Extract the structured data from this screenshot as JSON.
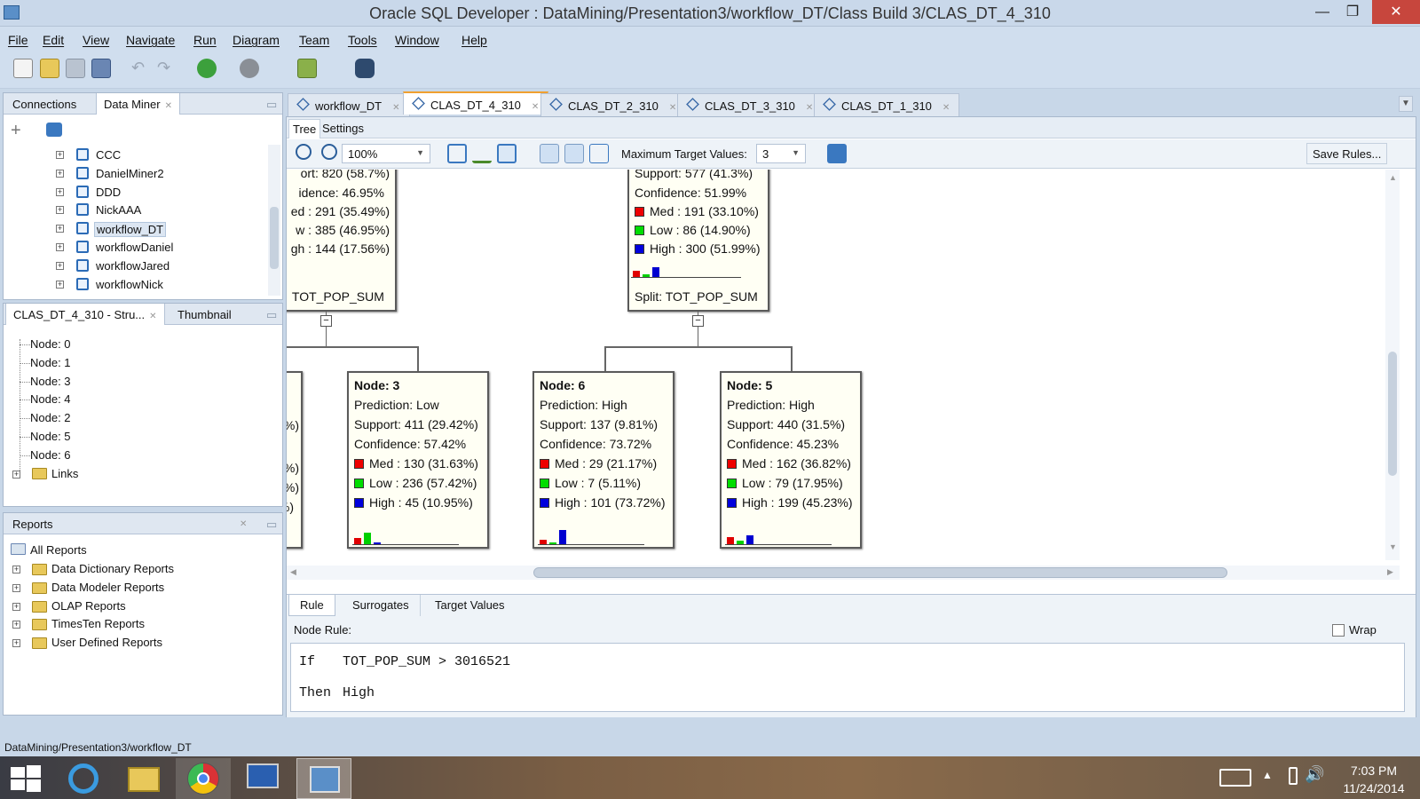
{
  "window": {
    "title": "Oracle SQL Developer : DataMining/Presentation3/workflow_DT/Class Build 3/CLAS_DT_4_310"
  },
  "menu": [
    "File",
    "Edit",
    "View",
    "Navigate",
    "Run",
    "Diagram",
    "Team",
    "Tools",
    "Window",
    "Help"
  ],
  "left_top": {
    "tabs": [
      "Connections",
      "Data Miner"
    ],
    "items": [
      "CCC",
      "DanielMiner2",
      "DDD",
      "NickAAA",
      "workflow_DT",
      "workflowDaniel",
      "workflowJared",
      "workflowNick"
    ],
    "selected": "workflow_DT"
  },
  "structure": {
    "tabs": [
      "CLAS_DT_4_310 - Stru...",
      "Thumbnail"
    ],
    "nodes": [
      "Node: 0",
      "Node: 1",
      "Node: 3",
      "Node: 4",
      "Node: 2",
      "Node: 5",
      "Node: 6"
    ],
    "links": "Links"
  },
  "reports": {
    "title": "Reports",
    "root": "All Reports",
    "items": [
      "Data Dictionary Reports",
      "Data Modeler Reports",
      "OLAP Reports",
      "TimesTen Reports",
      "User Defined Reports"
    ]
  },
  "editor_tabs": [
    "workflow_DT",
    "CLAS_DT_4_310",
    "CLAS_DT_2_310",
    "CLAS_DT_3_310",
    "CLAS_DT_1_310"
  ],
  "subtabs": [
    "Tree",
    "Settings"
  ],
  "tree_toolbar": {
    "zoom": "100%",
    "max_target_label": "Maximum Target Values:",
    "max_target_value": "3",
    "save_rules": "Save Rules..."
  },
  "tree": {
    "left_partial": {
      "support": "ort: 820 (58.7%)",
      "confidence": "idence: 46.95%",
      "med": "ed : 291  (35.49%)",
      "low": "w : 385  (46.95%)",
      "high": "gh : 144  (17.56%)",
      "split": "TOT_POP_SUM"
    },
    "right_partial": {
      "support": "Support: 577 (41.3%)",
      "confidence": "Confidence: 51.99%",
      "med": "Med : 191  (33.10%)",
      "low": "Low : 86  (14.90%)",
      "high": "High : 300  (51.99%)",
      "split": "Split: TOT_POP_SUM"
    },
    "left_edge_fragments": [
      "%)",
      "%)",
      "%)",
      "%)"
    ],
    "nodes": [
      {
        "title": "Node: 3",
        "prediction": "Prediction: Low",
        "support": "Support: 411 (29.42%)",
        "confidence": "Confidence: 57.42%",
        "med": "Med : 130  (31.63%)",
        "low": "Low : 236  (57.42%)",
        "high": "High : 45  (10.95%)",
        "bars": [
          31.63,
          57.42,
          10.95
        ]
      },
      {
        "title": "Node: 6",
        "prediction": "Prediction: High",
        "support": "Support: 137 (9.81%)",
        "confidence": "Confidence: 73.72%",
        "med": "Med : 29  (21.17%)",
        "low": "Low : 7  (5.11%)",
        "high": "High : 101  (73.72%)",
        "bars": [
          21.17,
          5.11,
          73.72
        ]
      },
      {
        "title": "Node: 5",
        "prediction": "Prediction: High",
        "support": "Support: 440 (31.5%)",
        "confidence": "Confidence: 45.23%",
        "med": "Med : 162  (36.82%)",
        "low": "Low : 79  (17.95%)",
        "high": "High : 199  (45.23%)",
        "bars": [
          36.82,
          17.95,
          45.23
        ]
      }
    ],
    "right_partial_bars": [
      33.1,
      14.9,
      51.99
    ]
  },
  "bottom": {
    "tabs": [
      "Rule",
      "Surrogates",
      "Target Values"
    ],
    "node_rule_label": "Node Rule:",
    "wrap_label": "Wrap",
    "rule_if": "If",
    "rule_condition": "TOT_POP_SUM > 3016521",
    "rule_then": "Then",
    "rule_result": "High"
  },
  "status": "DataMining/Presentation3/workflow_DT",
  "clock": {
    "time": "7:03 PM",
    "date": "11/24/2014"
  },
  "colors": {
    "med": "#e00000",
    "low": "#00d000",
    "high": "#0000d0"
  }
}
